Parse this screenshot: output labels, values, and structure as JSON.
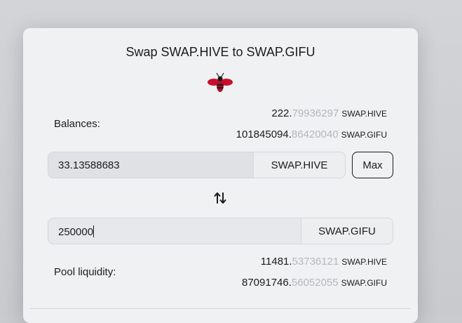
{
  "title": "Swap SWAP.HIVE to SWAP.GIFU",
  "logo": "hive-bee-logo",
  "balances": {
    "label": "Balances:",
    "rows": [
      {
        "int": "222.",
        "dec": "79936297",
        "symbol": "SWAP.HIVE"
      },
      {
        "int": "101845094.",
        "dec": "86420040",
        "symbol": "SWAP.GIFU"
      }
    ]
  },
  "from": {
    "value": "33.13588683",
    "token": "SWAP.HIVE"
  },
  "max_label": "Max",
  "swap_icon": "swap-arrows-icon",
  "to": {
    "value": "250000",
    "token": "SWAP.GIFU"
  },
  "pool": {
    "label": "Pool liquidity:",
    "rows": [
      {
        "int": "11481.",
        "dec": "53736121",
        "symbol": "SWAP.HIVE"
      },
      {
        "int": "87091746.",
        "dec": "56052055",
        "symbol": "SWAP.GIFU"
      }
    ]
  },
  "colors": {
    "accent": "#c8102e",
    "muted_decimals": "#b4b7bd"
  }
}
